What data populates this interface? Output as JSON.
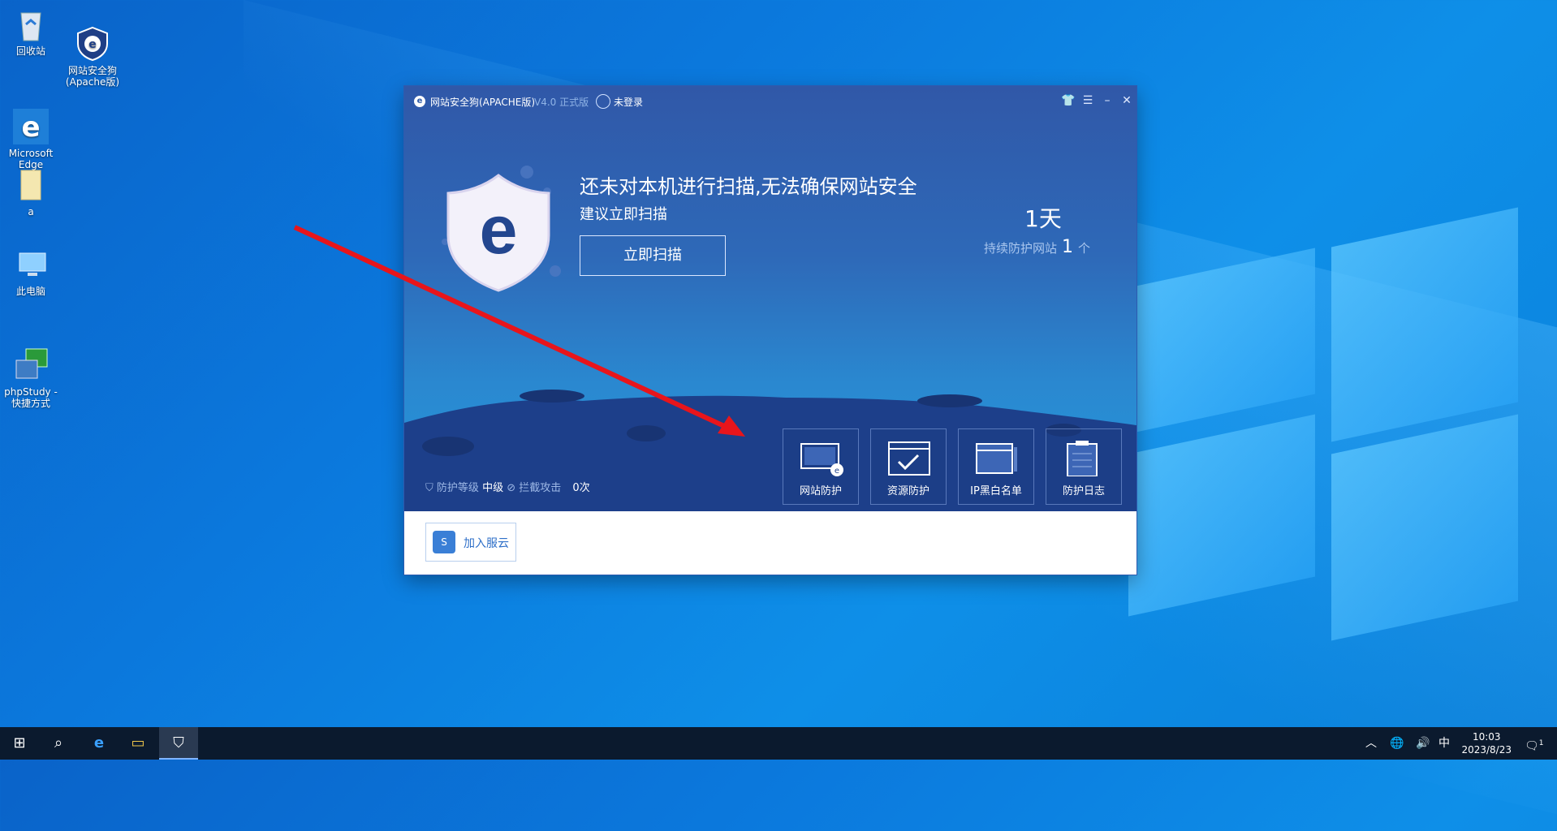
{
  "desktop": {
    "icons": [
      {
        "label": "回收站"
      },
      {
        "label": "网站安全狗\n(Apache版)"
      },
      {
        "label": "Microsoft\nEdge"
      },
      {
        "label": "a"
      },
      {
        "label": "此电脑"
      },
      {
        "label": "phpStudy -\n快捷方式"
      }
    ]
  },
  "app": {
    "title": "网站安全狗(APACHE版)",
    "version": "V4.0 正式版",
    "login": "未登录",
    "headline": "还未对本机进行扫描,无法确保网站安全",
    "subline": "建议立即扫描",
    "scan_button": "立即扫描",
    "days": "1天",
    "protect_label": "持续防护网站",
    "protect_count": "1",
    "protect_unit": "个",
    "status": {
      "level_label": "防护等级",
      "level_value": "中级",
      "intercept_label": "拦截攻击",
      "intercept_value": "0次"
    },
    "tools": [
      {
        "label": "网站防护",
        "icon": "monitor-shield-icon"
      },
      {
        "label": "资源防护",
        "icon": "folder-check-icon"
      },
      {
        "label": "IP黑白名单",
        "icon": "window-list-icon"
      },
      {
        "label": "防护日志",
        "icon": "clipboard-log-icon"
      }
    ],
    "cloud_button": "加入服云",
    "colors": {
      "hero_top": "#3058a8",
      "hero_bottom": "#2497db",
      "ground": "#1d3f8a"
    }
  },
  "taskbar": {
    "ime": "中",
    "time": "10:03",
    "date": "2023/8/23",
    "notification_count": "1"
  }
}
